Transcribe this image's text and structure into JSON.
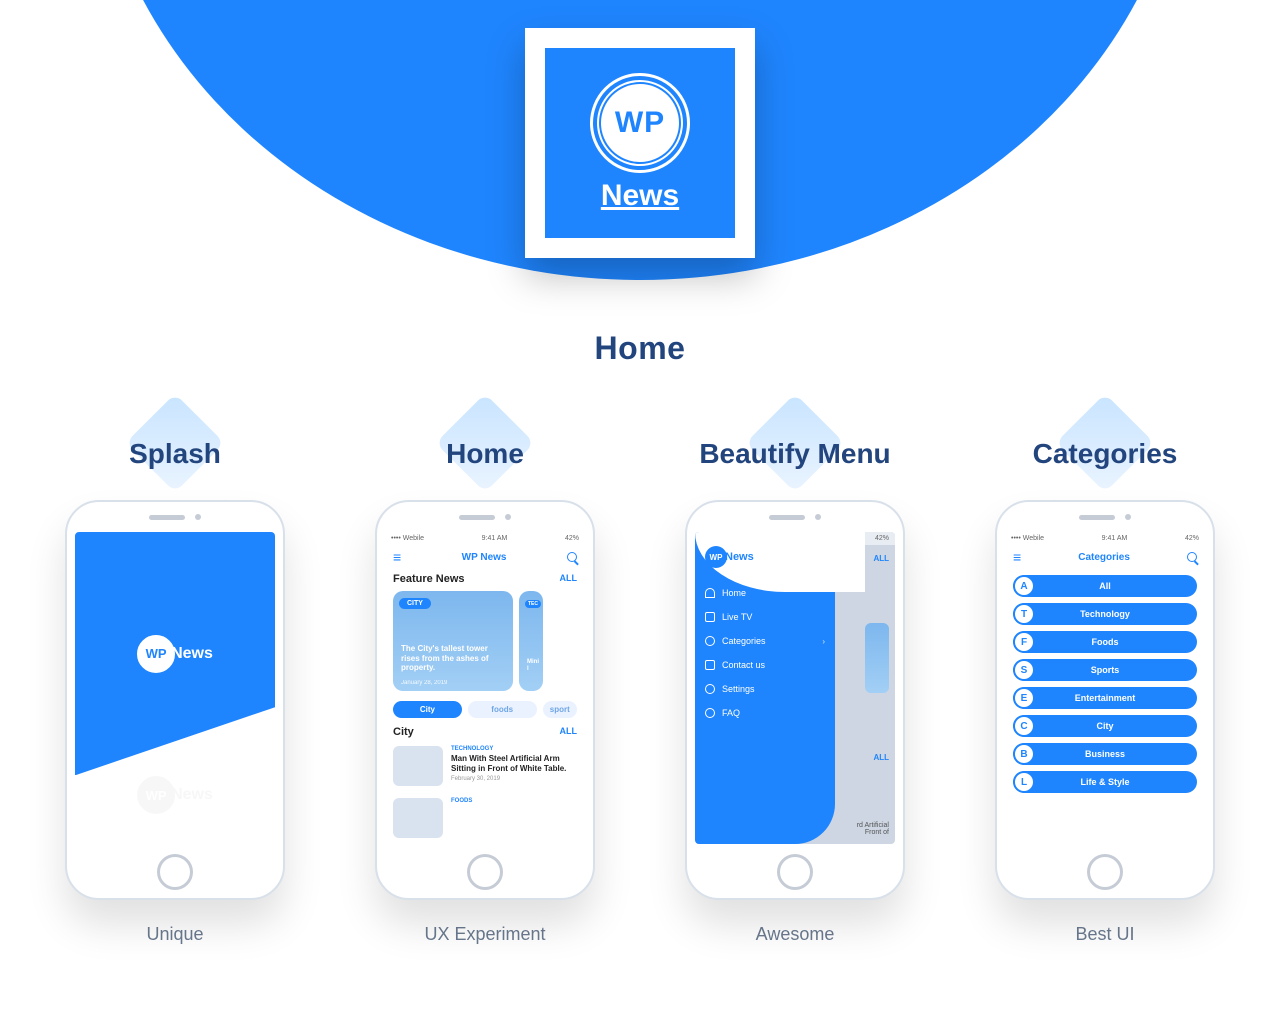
{
  "brand": {
    "wp": "WP",
    "news": "News"
  },
  "section_title": "Home",
  "status": {
    "carrier": "•••• Webile",
    "time": "9:41 AM",
    "battery": "42%"
  },
  "cards": [
    {
      "title": "Splash",
      "caption": "Unique"
    },
    {
      "title": "Home",
      "caption": "UX Experiment"
    },
    {
      "title": "Beautify Menu",
      "caption": "Awesome"
    },
    {
      "title": "Categories",
      "caption": "Best UI"
    }
  ],
  "home_screen": {
    "app_title": "WP News",
    "feature_heading": "Feature News",
    "all": "ALL",
    "feature_badge": "CITY",
    "feature_title": "The City's tallest tower rises from the ashes of property.",
    "feature_date": "January 28, 2019",
    "feature2_prefix": "Mini l",
    "pills": [
      "City",
      "foods",
      "sport"
    ],
    "city_heading": "City",
    "item1_cat": "TECHNOLOGY",
    "item1_title": "Man With Steel Artificial Arm Sitting in Front of White Table.",
    "item1_date": "February 30, 2019",
    "item2_cat": "FOODS"
  },
  "menu": {
    "brand": "News",
    "items": [
      {
        "label": "Home"
      },
      {
        "label": "Live TV"
      },
      {
        "label": "Categories",
        "chev": true
      },
      {
        "label": "Contact us"
      },
      {
        "label": "Settings"
      },
      {
        "label": "FAQ"
      }
    ],
    "bg_artificial": "rd Artificial\nFront of"
  },
  "categories_screen": {
    "header": "Categories",
    "items": [
      {
        "k": "A",
        "label": "All"
      },
      {
        "k": "T",
        "label": "Technology"
      },
      {
        "k": "F",
        "label": "Foods"
      },
      {
        "k": "S",
        "label": "Sports"
      },
      {
        "k": "E",
        "label": "Entertainment"
      },
      {
        "k": "C",
        "label": "City"
      },
      {
        "k": "B",
        "label": "Business"
      },
      {
        "k": "L",
        "label": "Life & Style"
      }
    ]
  }
}
